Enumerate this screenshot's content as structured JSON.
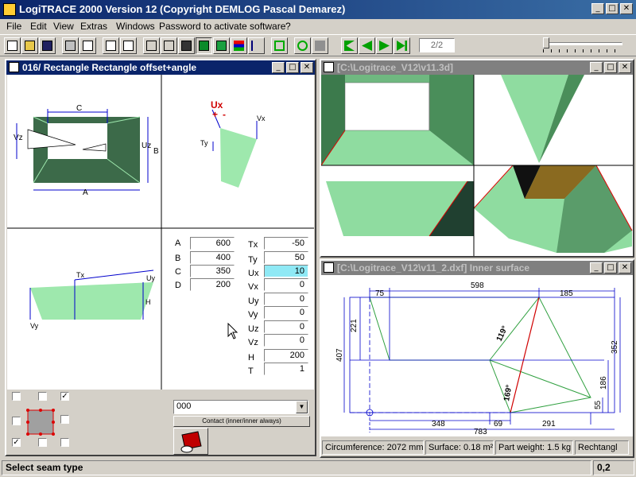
{
  "app": {
    "title": "LogiTRACE 2000  Version 12  (Copyright DEMLOG Pascal Demarez)"
  },
  "menu": [
    "File",
    "Edit",
    "View",
    "Extras",
    "Windows",
    "Password to activate software",
    "?"
  ],
  "toolbar": {
    "page_indicator": "2/2"
  },
  "left_window": {
    "title": "016/ Rectangle Rectangle offset+angle",
    "drawing_labels": {
      "c": "C",
      "a": "A",
      "b": "B",
      "uz": "Uz",
      "vz": "Vz",
      "ux": "Ux",
      "vx": "Vx",
      "ty": "Ty",
      "tx": "Tx",
      "uy": "Uy",
      "vy": "Vy",
      "h": "H",
      "plus": "+",
      "minus": "-"
    },
    "params_left": [
      {
        "label": "A",
        "value": "600"
      },
      {
        "label": "B",
        "value": "400"
      },
      {
        "label": "C",
        "value": "350"
      },
      {
        "label": "D",
        "value": "200"
      }
    ],
    "params_right": [
      {
        "label": "Tx",
        "value": "-50"
      },
      {
        "label": "Ty",
        "value": "50"
      },
      {
        "label": "Ux",
        "value": "10",
        "highlight": true
      },
      {
        "label": "Vx",
        "value": "0"
      },
      {
        "label": "Uy",
        "value": "0"
      },
      {
        "label": "Vy",
        "value": "0"
      },
      {
        "label": "Uz",
        "value": "0"
      },
      {
        "label": "Vz",
        "value": "0"
      },
      {
        "label": "H",
        "value": "200"
      },
      {
        "label": "T",
        "value": "1"
      }
    ],
    "combo_value": "000",
    "contact_button": "Contact (inner/inner always)"
  },
  "window_3d": {
    "title": "[C:\\Logitrace_V12\\v11.3d]"
  },
  "window_dxf": {
    "title": "[C:\\Logitrace_V12\\v11_2.dxf]  Inner surface",
    "dims": {
      "d75": "75",
      "d598": "598",
      "d185": "185",
      "d221": "221",
      "d407": "407",
      "d352": "352",
      "d186": "186",
      "d55": "55",
      "d348": "348",
      "d69": "69",
      "d291": "291",
      "d783": "783",
      "a119": "119°",
      "a169": "169°"
    },
    "status": {
      "circumference": "Circumference: 2072 mm",
      "surface": "Surface: 0.18 m²",
      "weight": "Part weight: 1.5 kg",
      "shape": "Rechtangl"
    }
  },
  "statusbar": {
    "message": "Select seam type",
    "value": "0,2"
  },
  "colors": {
    "shape_green": "#9ee8ad",
    "shape_dark": "#3c6a49",
    "title_active": "#0a246a",
    "blue": "#0000cc"
  }
}
